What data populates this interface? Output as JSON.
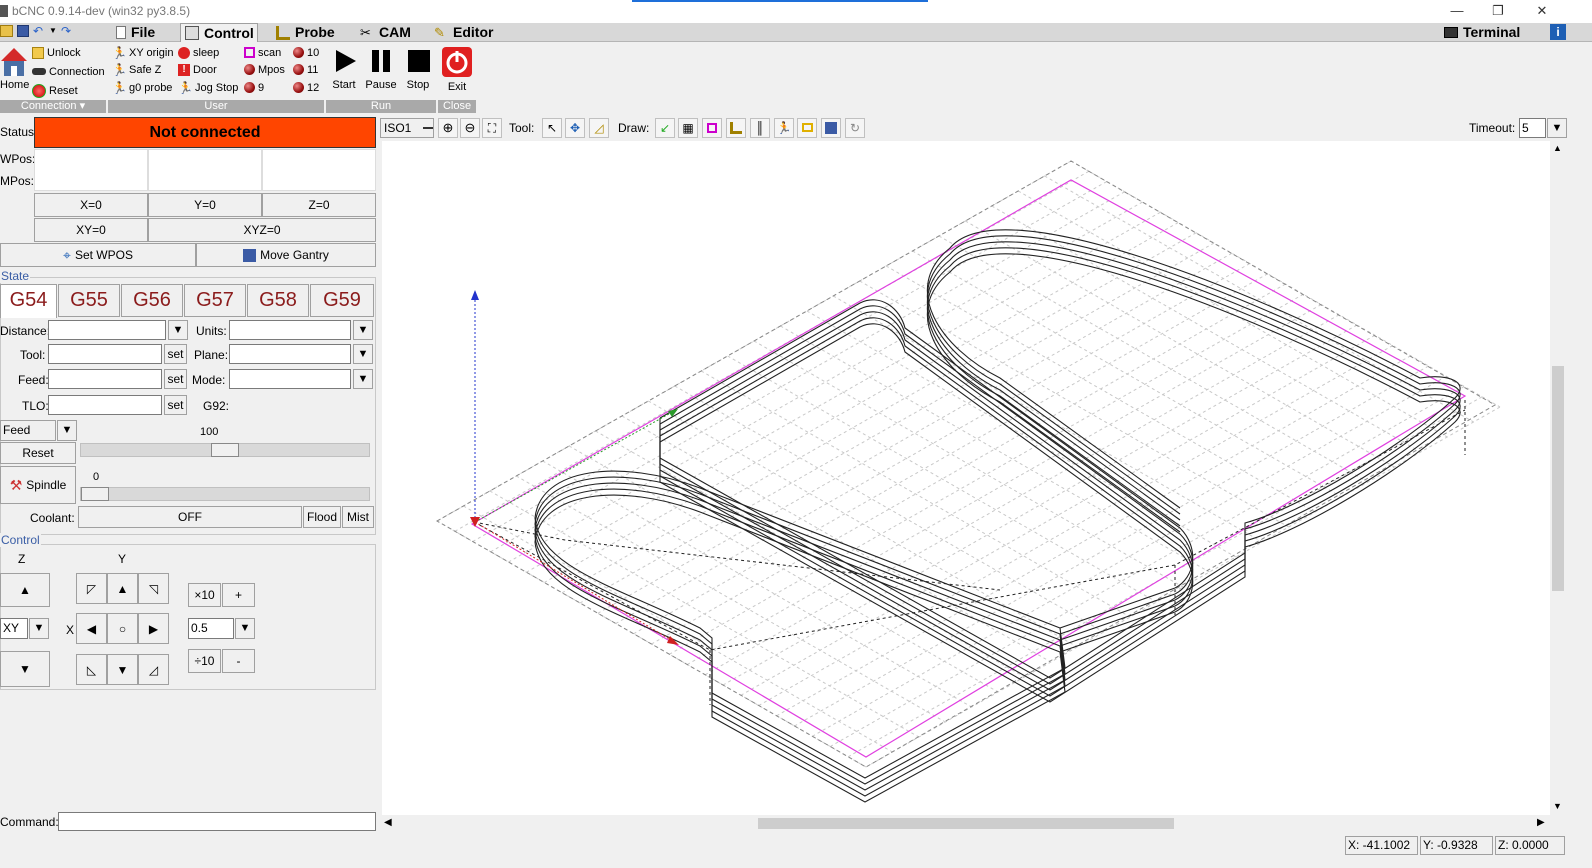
{
  "window": {
    "title": "bCNC 0.9.14-dev (win32 py3.8.5)",
    "minimize": "—",
    "restore": "❐",
    "close": "✕"
  },
  "tabs": {
    "file": "File",
    "control": "Control",
    "probe": "Probe",
    "cam": "CAM",
    "editor": "Editor",
    "terminal": "Terminal"
  },
  "ribbon": {
    "connection": {
      "home": "Home",
      "unlock": "Unlock",
      "connection": "Connection",
      "reset": "Reset",
      "label": "Connection"
    },
    "user": {
      "xy_origin": "XY origin",
      "safe_z": "Safe Z",
      "g0_probe": "g0 probe",
      "sleep": "sleep",
      "door": "Door",
      "jog_stop": "Jog Stop",
      "scan": "scan",
      "mpos": "Mpos",
      "b9": "9",
      "b10": "10",
      "b11": "11",
      "b12": "12",
      "label": "User"
    },
    "run": {
      "start": "Start",
      "pause": "Pause",
      "stop": "Stop",
      "label": "Run"
    },
    "close": {
      "exit": "Exit",
      "label": "Close"
    }
  },
  "dro": {
    "status_label": "Status:",
    "status_value": "Not connected",
    "status_color": "#ff4500",
    "wpos_label": "WPos:",
    "mpos_label": "MPos:",
    "x0": "X=0",
    "y0": "Y=0",
    "z0": "Z=0",
    "xy0": "XY=0",
    "xyz0": "XYZ=0",
    "set_wpos": "Set WPOS",
    "move_gantry": "Move Gantry"
  },
  "state": {
    "title": "State",
    "wcs": [
      "G54",
      "G55",
      "G56",
      "G57",
      "G58",
      "G59"
    ],
    "distance_label": "Distance:",
    "units_label": "Units:",
    "tool_label": "Tool:",
    "plane_label": "Plane:",
    "feed_label": "Feed:",
    "mode_label": "Mode:",
    "tlo_label": "TLO:",
    "g92_label": "G92:",
    "set": "set",
    "override_mode": "Feed",
    "override_value": "100",
    "override_fraction": 0.5,
    "reset": "Reset",
    "spindle": "Spindle",
    "spindle_value": "0",
    "spindle_fraction": 0.0,
    "coolant_label": "Coolant:",
    "coolant_value": "OFF",
    "flood": "Flood",
    "mist": "Mist"
  },
  "control": {
    "title": "Control",
    "z_label": "Z",
    "y_label": "Y",
    "x_label": "X",
    "axis_select": "XY",
    "x10": "×10",
    "plus": "+",
    "step": "0.5",
    "div10": "÷10",
    "minus": "-"
  },
  "command": {
    "label": "Command:",
    "value": ""
  },
  "toolbar": {
    "view": "ISO1",
    "tool_label": "Tool:",
    "draw_label": "Draw:",
    "timeout_label": "Timeout:",
    "timeout_value": "5"
  },
  "coords": {
    "x": "X: -41.1002",
    "y": "Y: -0.9328",
    "z": "Z: 0.0000"
  }
}
